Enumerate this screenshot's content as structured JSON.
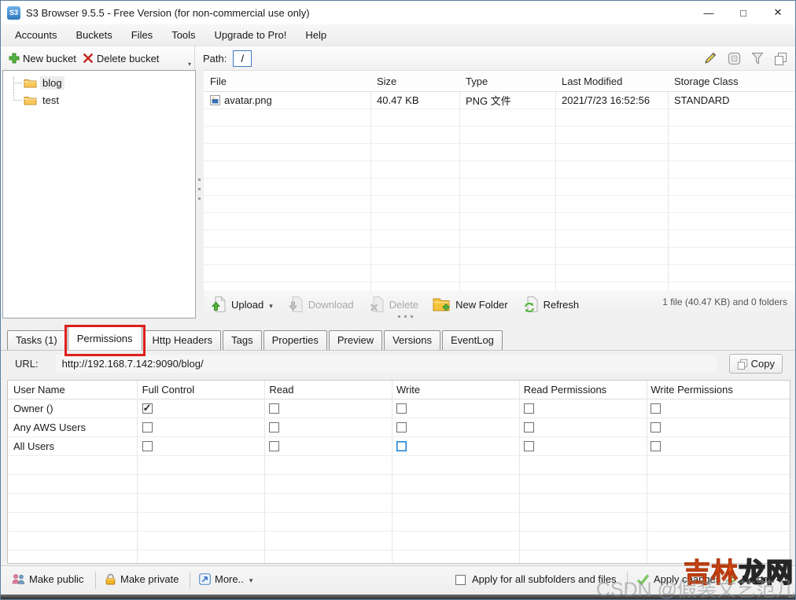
{
  "window": {
    "icon_label": "S3",
    "title": "S3 Browser 9.5.5 - Free Version (for non-commercial use only)",
    "minimize": "—",
    "maximize": "□",
    "close": "✕"
  },
  "menu_items": [
    "Accounts",
    "Buckets",
    "Files",
    "Tools",
    "Upgrade to Pro!",
    "Help"
  ],
  "bucket_toolbar": {
    "new_bucket": "New bucket",
    "delete_bucket": "Delete bucket"
  },
  "path_bar": {
    "label": "Path:",
    "value": "/"
  },
  "tree": [
    {
      "label": "blog",
      "selected": true
    },
    {
      "label": "test",
      "selected": false
    }
  ],
  "file_list": {
    "columns": [
      "File",
      "Size",
      "Type",
      "Last Modified",
      "Storage Class"
    ],
    "rows": [
      [
        "avatar.png",
        "40.47 KB",
        "PNG 文件",
        "2021/7/23 16:52:56",
        "STANDARD"
      ]
    ],
    "summary": "1 file (40.47 KB) and 0 folders"
  },
  "file_actions": {
    "upload": "Upload",
    "download": "Download",
    "delete": "Delete",
    "new_folder": "New Folder",
    "refresh": "Refresh"
  },
  "tabs": {
    "items": [
      "Tasks (1)",
      "Permissions",
      "Http Headers",
      "Tags",
      "Properties",
      "Preview",
      "Versions",
      "EventLog"
    ],
    "active_index": 1
  },
  "url_bar": {
    "label": "URL:",
    "value": "http://192.168.7.142:9090/blog/",
    "copy": "Copy"
  },
  "permissions": {
    "columns": [
      "User Name",
      "Full Control",
      "Read",
      "Write",
      "Read Permissions",
      "Write Permissions"
    ],
    "rows": [
      {
        "user": "Owner ()",
        "checks": [
          "checked",
          "unchecked",
          "unchecked",
          "unchecked",
          "unchecked"
        ]
      },
      {
        "user": "Any AWS Users",
        "checks": [
          "unchecked",
          "unchecked",
          "unchecked",
          "unchecked",
          "unchecked"
        ]
      },
      {
        "user": "All Users",
        "checks": [
          "unchecked",
          "unchecked",
          "focused",
          "unchecked",
          "unchecked"
        ]
      }
    ]
  },
  "footer": {
    "make_public": "Make public",
    "make_private": "Make private",
    "more": "More..",
    "apply_subfolders": "Apply for all subfolders and files",
    "apply_subfolders_checked": false,
    "apply_changes": "Apply changes",
    "reload": "Reload"
  },
  "watermark": {
    "line1_part1": "吉林",
    "line1_part2": "龙网",
    "line2": "CSDN @假装文艺范儿"
  },
  "colors": {
    "annotation_red": "#dd1f1c",
    "path_input_border": "#3d7bbf",
    "focus_blue": "#1a7fd4",
    "green": "#4aa73c",
    "delete_red": "#cf2a27"
  }
}
